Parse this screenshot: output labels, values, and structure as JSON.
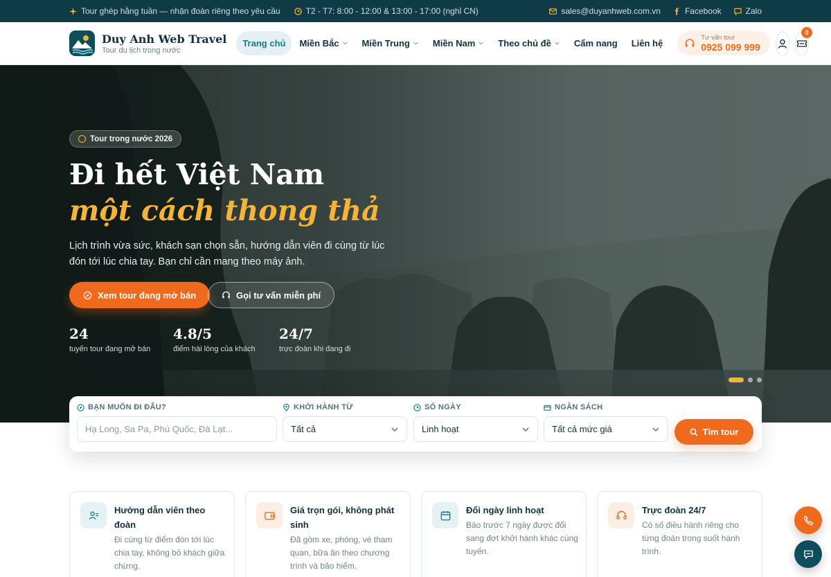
{
  "topbar": {
    "promo": "Tour ghép hằng tuần — nhận đoàn riêng theo yêu cầu",
    "hours": "T2 - T7: 8:00 - 12:00 & 13:00 - 17:00 (nghỉ CN)",
    "email": "sales@duyanhweb.com.vn",
    "facebook": "Facebook",
    "zalo": "Zalo"
  },
  "brand": {
    "name": "Duy Anh Web Travel",
    "tagline": "Tour du lịch trong nước"
  },
  "nav": [
    {
      "label": "Trang chủ",
      "dropdown": false,
      "active": true
    },
    {
      "label": "Miền Bắc",
      "dropdown": true
    },
    {
      "label": "Miền Trung",
      "dropdown": true
    },
    {
      "label": "Miền Nam",
      "dropdown": true
    },
    {
      "label": "Theo chủ đề",
      "dropdown": true
    },
    {
      "label": "Cẩm nang",
      "dropdown": false
    },
    {
      "label": "Liên hệ",
      "dropdown": false
    }
  ],
  "hotline": {
    "label": "Tư vấn tour",
    "number": "0925 099 999"
  },
  "cart_count": "0",
  "hero": {
    "badge": "Tour trong nước 2026",
    "title_line1": "Đi hết Việt Nam",
    "title_line2": "một cách thong thả",
    "lead": "Lịch trình vừa sức, khách sạn chọn sẵn, hướng dẫn viên đi cùng từ lúc đón tới lúc chia tay. Bạn chỉ cần mang theo máy ảnh.",
    "cta_primary": "Xem tour đang mở bán",
    "cta_secondary": "Gọi tư vấn miễn phí",
    "stats": [
      {
        "value": "24",
        "label": "tuyến tour đang mở bán"
      },
      {
        "value": "4.8/5",
        "label": "điểm hài lòng của khách"
      },
      {
        "value": "24/7",
        "label": "trực đoàn khi đang đi"
      }
    ],
    "slides": 3,
    "active_slide": 1
  },
  "search": {
    "destination": {
      "label": "BẠN MUỐN ĐI ĐÂU?",
      "placeholder": "Hạ Long, Sa Pa, Phú Quốc, Đà Lạt..."
    },
    "departure": {
      "label": "KHỞI HÀNH TỪ",
      "value": "Tất cả"
    },
    "days": {
      "label": "SỐ NGÀY",
      "value": "Linh hoạt"
    },
    "budget": {
      "label": "NGÂN SÁCH",
      "value": "Tất cả mức giá"
    },
    "button": "Tìm tour"
  },
  "features": [
    {
      "icon": "guide-icon",
      "title": "Hướng dẫn viên theo đoàn",
      "desc": "Đi cùng từ điểm đón tới lúc chia tay, không bỏ khách giữa chừng."
    },
    {
      "icon": "wallet-icon",
      "title": "Giá trọn gói, không phát sinh",
      "desc": "Đã gồm xe, phòng, vé tham quan, bữa ăn theo chương trình và bảo hiểm."
    },
    {
      "icon": "calendar-icon",
      "title": "Đổi ngày linh hoạt",
      "desc": "Báo trước 7 ngày được đổi sang đợt khởi hành khác cùng tuyến."
    },
    {
      "icon": "headset-icon",
      "title": "Trực đoàn 24/7",
      "desc": "Có số điều hành riêng cho từng đoàn trong suốt hành trình."
    }
  ],
  "colors": {
    "brand_dark": "#0f3b47",
    "accent": "#ef6a1d",
    "gold": "#f4b43a",
    "teal": "#15798c"
  }
}
